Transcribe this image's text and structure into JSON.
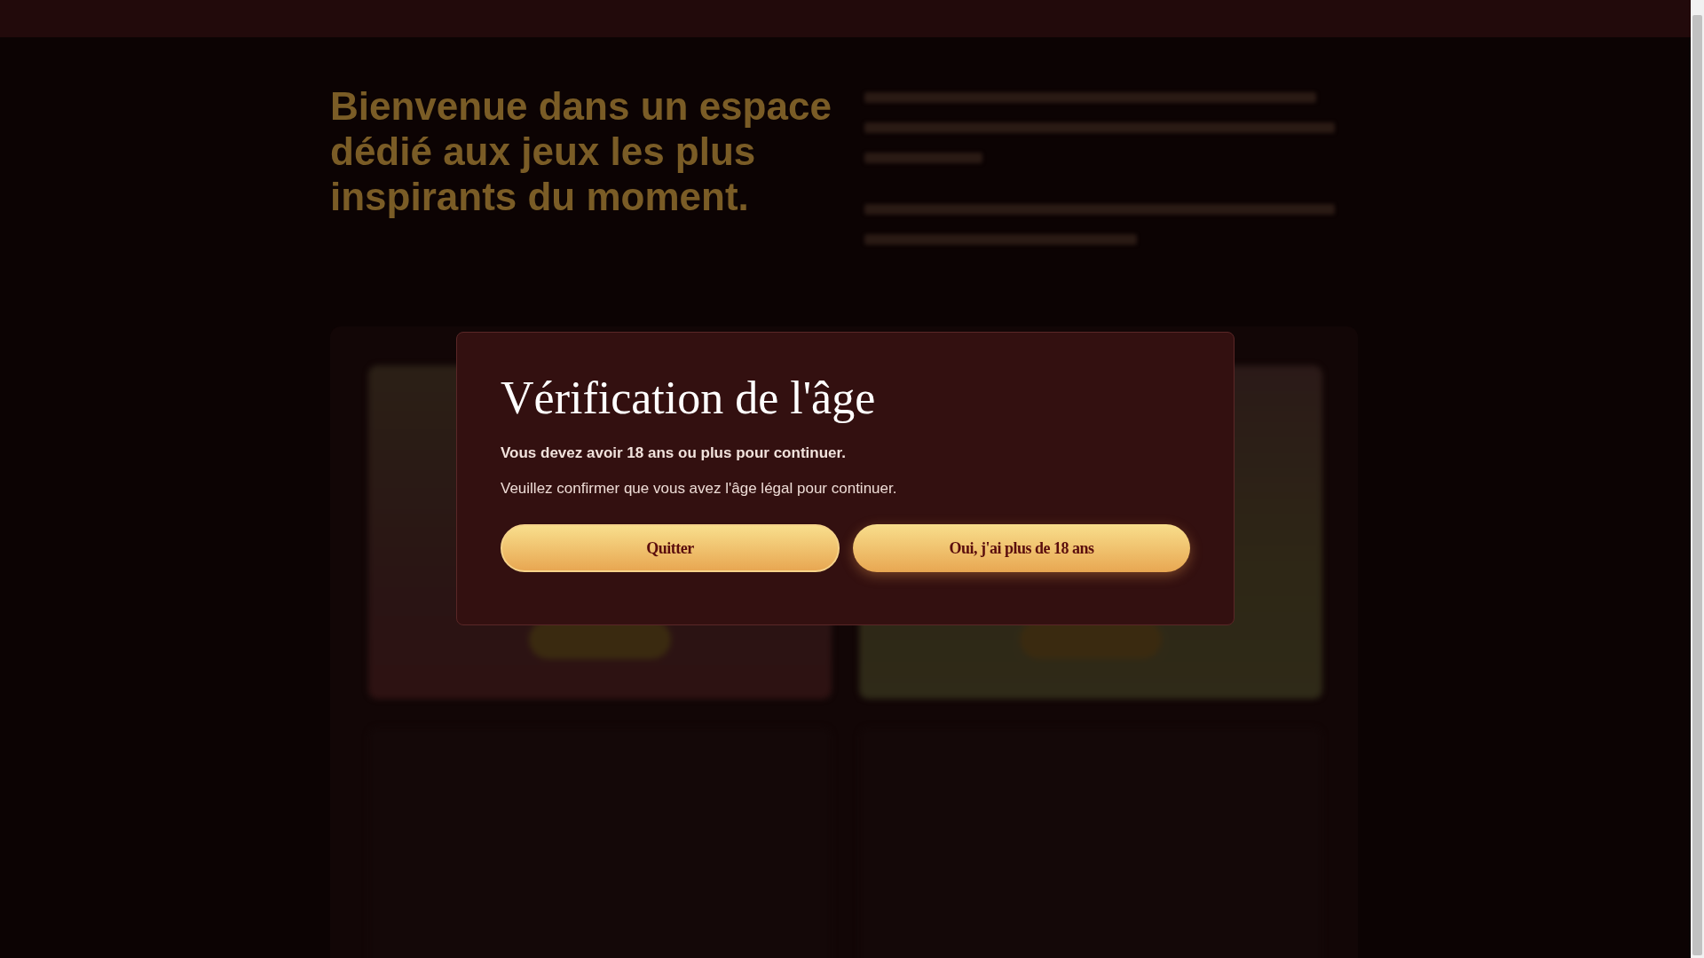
{
  "page": {
    "heading": "Bienvenue dans un espace dédié aux jeux les plus inspirants du moment."
  },
  "modal": {
    "title": "Vérification de l'âge",
    "warning": "Vous devez avoir 18 ans ou plus pour continuer.",
    "message": "Veuillez confirmer que vous avez l'âge légal pour continuer.",
    "buttons": [
      {
        "label": "Quitter",
        "kind": "outline"
      },
      {
        "label": "Oui, j'ai plus de 18 ans",
        "kind": "glow"
      }
    ]
  }
}
